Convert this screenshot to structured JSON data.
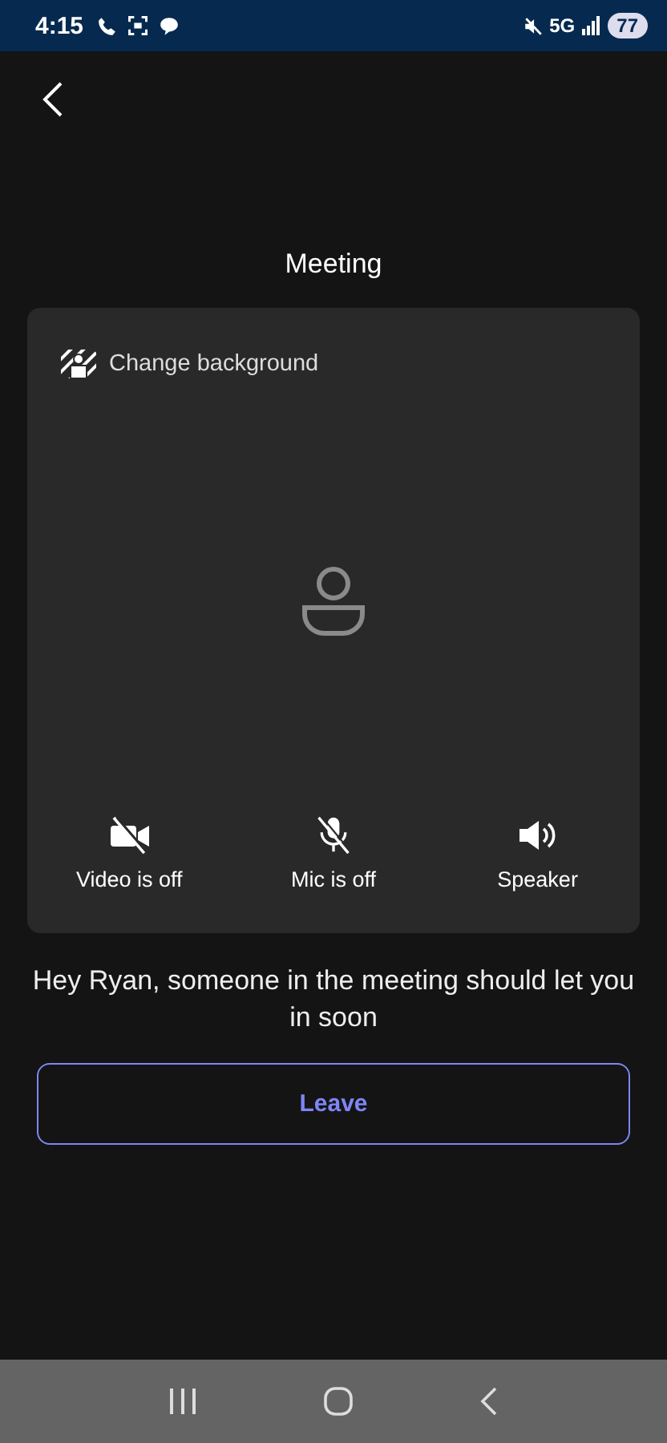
{
  "status_bar": {
    "time": "4:15",
    "network": "5G",
    "battery": "77"
  },
  "title": "Meeting",
  "preview": {
    "change_background": "Change background"
  },
  "controls": [
    {
      "kind": "video",
      "label": "Video is off",
      "on": false
    },
    {
      "kind": "mic",
      "label": "Mic is off",
      "on": false
    },
    {
      "kind": "speaker",
      "label": "Speaker",
      "on": true
    }
  ],
  "message": "Hey Ryan, someone in the meeting should let you in soon",
  "leave_button": "Leave"
}
